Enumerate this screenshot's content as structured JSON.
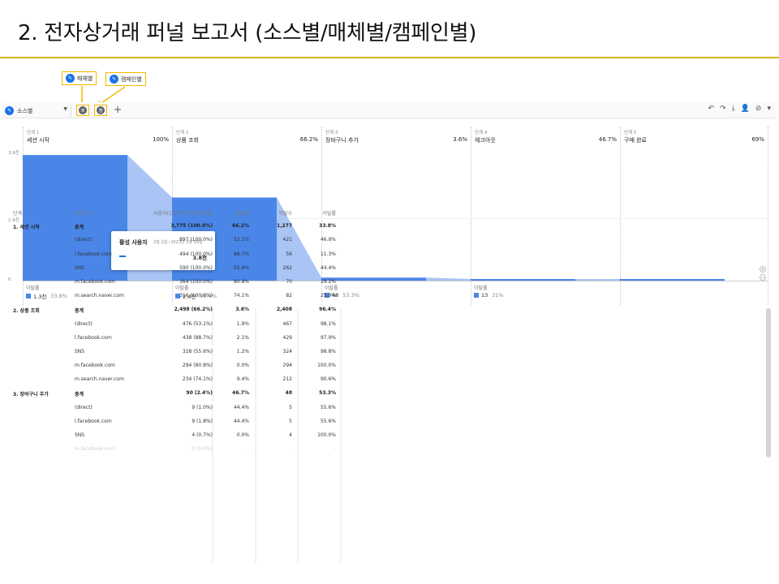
{
  "slide": {
    "title": "2. 전자상거래 퍼널 보고서 (소스별/매체별/캠페인별)"
  },
  "callouts": {
    "medium": "매체별",
    "campaign": "캠페인별"
  },
  "toolbar": {
    "segment": "소스별",
    "chip1": "매",
    "chip2": "캠"
  },
  "colors": {
    "bar": "#4a86e8",
    "bar_light": "#a9c4f5",
    "accent": "#f5b800"
  },
  "funnel": {
    "steps": [
      {
        "sub": "단계 1",
        "name": "세션 시작",
        "pct": "100%"
      },
      {
        "sub": "단계 2",
        "name": "상품 조회",
        "pct": "66.2%"
      },
      {
        "sub": "단계 3",
        "name": "장바구니 추가",
        "pct": "3.6%"
      },
      {
        "sub": "단계 4",
        "name": "체크아웃",
        "pct": "46.7%"
      },
      {
        "sub": "단계 5",
        "name": "구매 완료",
        "pct": "69%"
      }
    ],
    "y_ticks": [
      "3.9천",
      "1.9천",
      "0"
    ],
    "dropoffs": [
      {
        "label": "이탈률",
        "value": "1.3천",
        "pct": "33.8%"
      },
      {
        "label": "이탈률",
        "value": "2.4천",
        "pct": "96.4%"
      },
      {
        "label": "이탈률",
        "value": "48",
        "pct": "53.3%"
      },
      {
        "label": "이탈률",
        "value": "13",
        "pct": "31%"
      }
    ]
  },
  "chart_data": {
    "type": "bar",
    "categories": [
      "세션 시작",
      "상품 조회",
      "장바구니 추가",
      "체크아웃",
      "구매 완료"
    ],
    "values": [
      3775,
      2498,
      90,
      42,
      29
    ],
    "ylim": [
      0,
      3900
    ]
  },
  "tooltip": {
    "title": "활성 사용자",
    "date": "2월 1일~2023년 2월 28일",
    "value": "3.8천"
  },
  "table": {
    "headers": [
      "단계",
      "세션 소스",
      "사용자(1단계와 비교한 비율)",
      "완료율",
      "이탈수",
      "이탈률"
    ],
    "rows": [
      {
        "step": "1. 세션 시작",
        "src": "총계",
        "users": "3,775 (100.0%)",
        "comp": "66.2%",
        "ab": "1,277",
        "abr": "33.8%",
        "bold": true
      },
      {
        "step": "",
        "src": "(direct)",
        "users": "897 (100.0%)",
        "comp": "53.1%",
        "ab": "421",
        "abr": "46.9%"
      },
      {
        "step": "",
        "src": "l.facebook.com",
        "users": "494 (100.0%)",
        "comp": "88.7%",
        "ab": "56",
        "abr": "11.3%"
      },
      {
        "step": "",
        "src": "SNS",
        "users": "590 (100.0%)",
        "comp": "55.6%",
        "ab": "262",
        "abr": "44.4%"
      },
      {
        "step": "",
        "src": "m.facebook.com",
        "users": "364 (100.0%)",
        "comp": "80.8%",
        "ab": "70",
        "abr": "19.2%"
      },
      {
        "step": "",
        "src": "m.search.naver.com",
        "users": "316 (100.0%)",
        "comp": "74.1%",
        "ab": "82",
        "abr": "25.9%"
      },
      {
        "step": "2. 상품 조회",
        "src": "총계",
        "users": "2,498 (66.2%)",
        "comp": "3.6%",
        "ab": "2,408",
        "abr": "96.4%",
        "bold": true
      },
      {
        "step": "",
        "src": "(direct)",
        "users": "476 (53.1%)",
        "comp": "1.9%",
        "ab": "467",
        "abr": "98.1%"
      },
      {
        "step": "",
        "src": "l.facebook.com",
        "users": "438 (88.7%)",
        "comp": "2.1%",
        "ab": "429",
        "abr": "97.9%"
      },
      {
        "step": "",
        "src": "SNS",
        "users": "328 (55.6%)",
        "comp": "1.2%",
        "ab": "324",
        "abr": "98.8%"
      },
      {
        "step": "",
        "src": "m.facebook.com",
        "users": "294 (80.8%)",
        "comp": "0.0%",
        "ab": "294",
        "abr": "100.0%"
      },
      {
        "step": "",
        "src": "m.search.naver.com",
        "users": "234 (74.1%)",
        "comp": "9.4%",
        "ab": "212",
        "abr": "90.6%"
      },
      {
        "step": "3. 장바구니 추가",
        "src": "총계",
        "users": "90 (2.4%)",
        "comp": "46.7%",
        "ab": "48",
        "abr": "53.3%",
        "bold": true
      },
      {
        "step": "",
        "src": "(direct)",
        "users": "9 (1.0%)",
        "comp": "44.4%",
        "ab": "5",
        "abr": "55.6%"
      },
      {
        "step": "",
        "src": "l.facebook.com",
        "users": "9 (1.8%)",
        "comp": "44.4%",
        "ab": "5",
        "abr": "55.6%"
      },
      {
        "step": "",
        "src": "SNS",
        "users": "4 (0.7%)",
        "comp": "0.0%",
        "ab": "4",
        "abr": "100.0%"
      },
      {
        "step": "",
        "src": "m.facebook.com",
        "users": "0 (0.0%)",
        "comp": "-",
        "ab": "-",
        "abr": "-",
        "fade": true
      }
    ]
  }
}
